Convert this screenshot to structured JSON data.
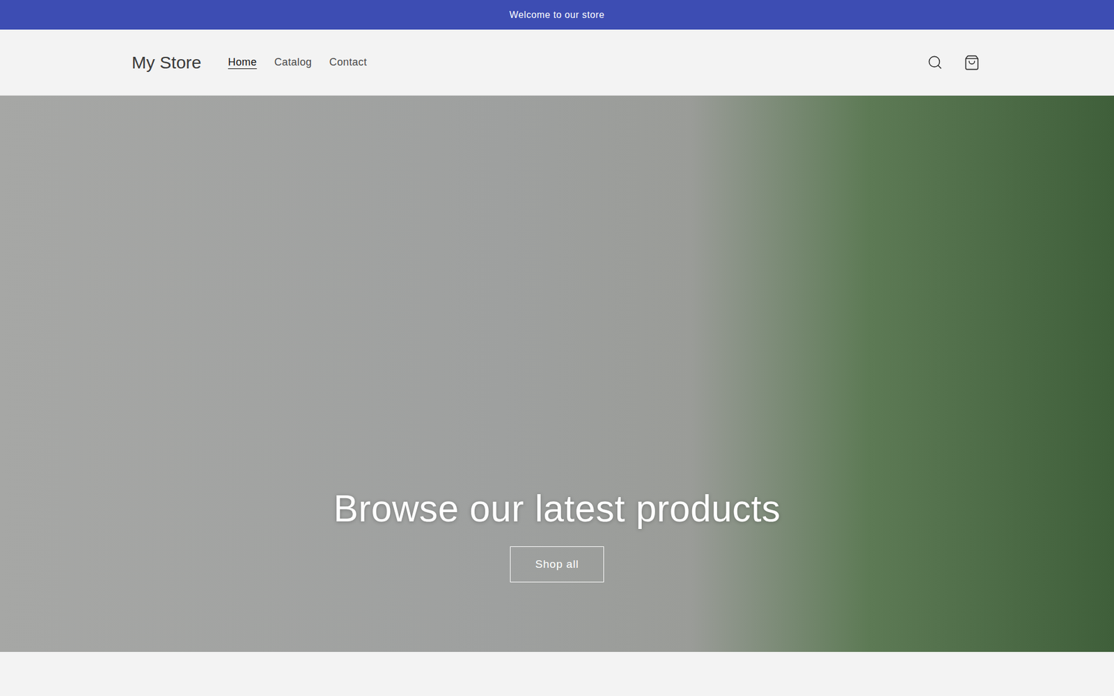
{
  "announcement": {
    "text": "Welcome to our store"
  },
  "header": {
    "logo": "My Store",
    "nav": [
      {
        "label": "Home",
        "selected": true
      },
      {
        "label": "Catalog",
        "selected": false
      },
      {
        "label": "Contact",
        "selected": false
      }
    ]
  },
  "hero": {
    "heading": "Browse our latest products",
    "button": "Shop all"
  }
}
